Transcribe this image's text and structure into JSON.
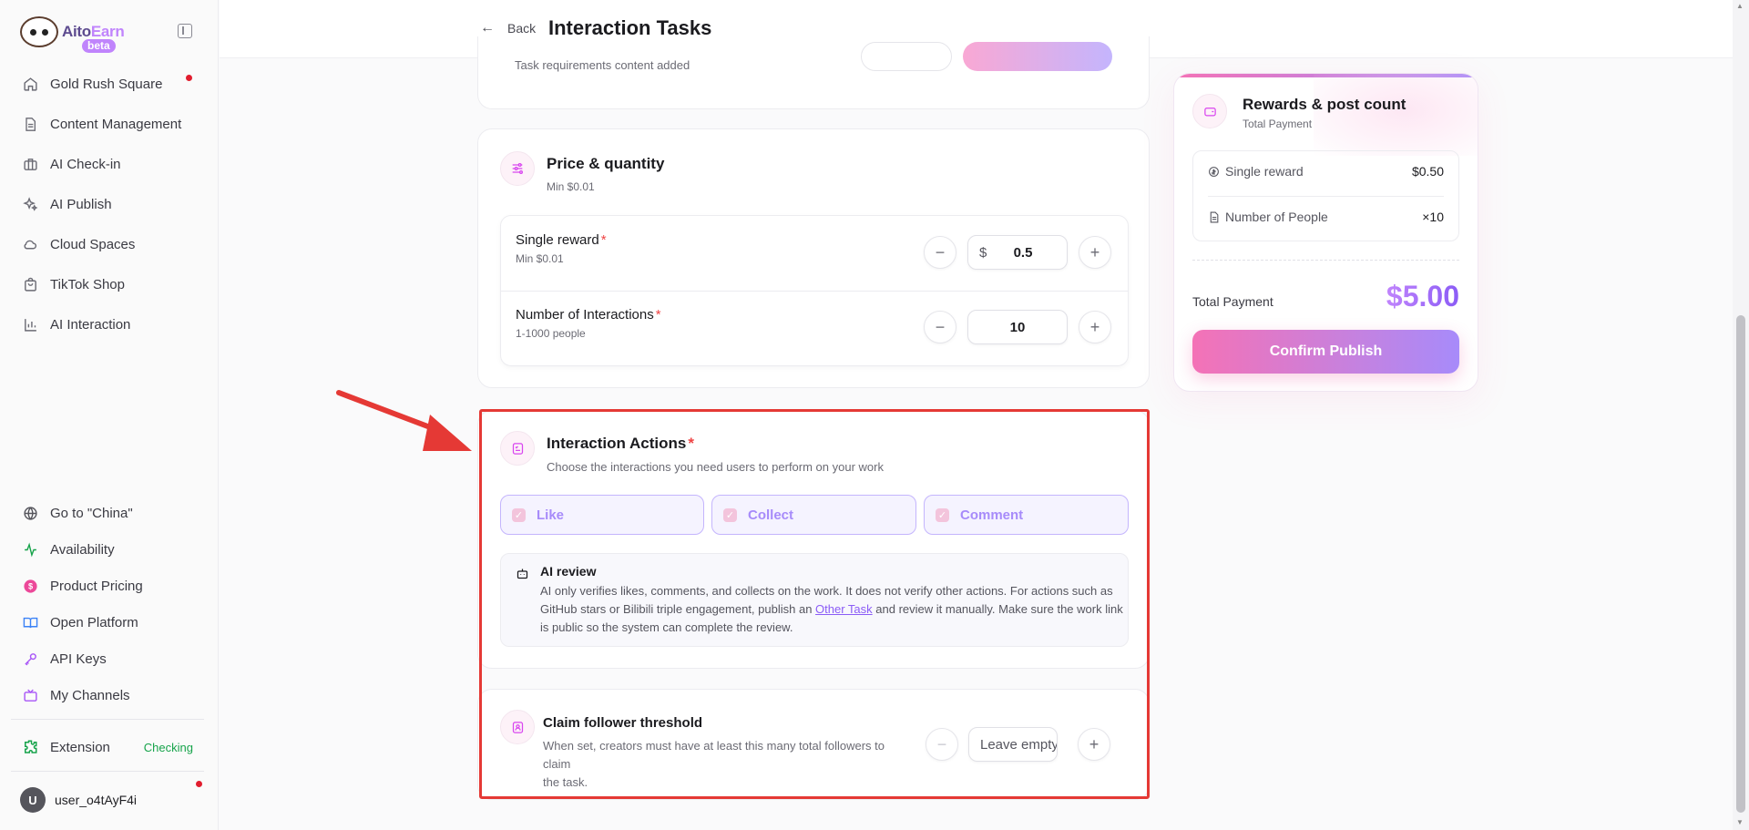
{
  "app": {
    "logo_text_a": "Aito",
    "logo_text_b": "Earn",
    "logo_badge": "beta"
  },
  "sidebar": {
    "items": [
      {
        "label": "Gold Rush Square",
        "icon": "home-icon",
        "dot": true
      },
      {
        "label": "Content Management",
        "icon": "document-icon"
      },
      {
        "label": "AI Check-in",
        "icon": "briefcase-icon"
      },
      {
        "label": "AI Publish",
        "icon": "sparkles-icon"
      },
      {
        "label": "Cloud Spaces",
        "icon": "cloud-icon"
      },
      {
        "label": "TikTok Shop",
        "icon": "shopping-bag-icon"
      },
      {
        "label": "AI Interaction",
        "icon": "bar-chart-icon"
      }
    ],
    "bottom_items": [
      {
        "label": "Go to \"China\"",
        "icon": "globe-icon"
      },
      {
        "label": "Availability",
        "icon": "activity-icon"
      },
      {
        "label": "Product Pricing",
        "icon": "dollar-circle-icon"
      },
      {
        "label": "Open Platform",
        "icon": "book-icon"
      },
      {
        "label": "API Keys",
        "icon": "key-icon"
      },
      {
        "label": "My Channels",
        "icon": "tv-icon"
      }
    ],
    "extension": {
      "label": "Extension",
      "status": "Checking"
    },
    "user": {
      "initial": "U",
      "name": "user_o4tAyF4i"
    }
  },
  "header": {
    "back_label": "Back",
    "title": "Interaction Tasks"
  },
  "top_card": {
    "subtitle": "Task requirements content added"
  },
  "price_card": {
    "title": "Price & quantity",
    "subtitle": "Min $0.01",
    "single_reward": {
      "label": "Single reward",
      "required": "*",
      "hint": "Min $0.01",
      "currency": "$",
      "value": "0.5"
    },
    "interactions": {
      "label": "Number of Interactions",
      "required": "*",
      "hint": "1-1000 people",
      "value": "10"
    }
  },
  "actions_card": {
    "title": "Interaction Actions",
    "required": "*",
    "subtitle": "Choose the interactions you need users to perform on your work",
    "chips": [
      "Like",
      "Collect",
      "Comment"
    ],
    "ai_review": {
      "title": "AI review",
      "line1": "AI only verifies likes, comments, and collects on the work. It does not verify other actions. For actions such as",
      "line2_pre": "GitHub stars or Bilibili triple engagement, publish an ",
      "line2_link": "Other Task",
      "line2_post": " and review it manually. Make sure the work link",
      "line3": "is public so the system can complete the review."
    }
  },
  "threshold_card": {
    "title": "Claim follower threshold",
    "desc_line1": "When set, creators must have at least this many total followers to claim",
    "desc_line2": "the task.",
    "placeholder": "Leave empty for no limit"
  },
  "rewards_panel": {
    "title": "Rewards & post count",
    "subtitle": "Total Payment",
    "single_reward_label": "Single reward",
    "single_reward_value": "$0.50",
    "people_label": "Number of People",
    "people_value": "×10",
    "total_label": "Total Payment",
    "total_value": "$5.00",
    "confirm_label": "Confirm Publish"
  },
  "colors": {
    "accent_pink": "#f472b6",
    "accent_purple": "#a78bfa",
    "annotation_red": "#e53935",
    "status_green": "#16a34a"
  }
}
